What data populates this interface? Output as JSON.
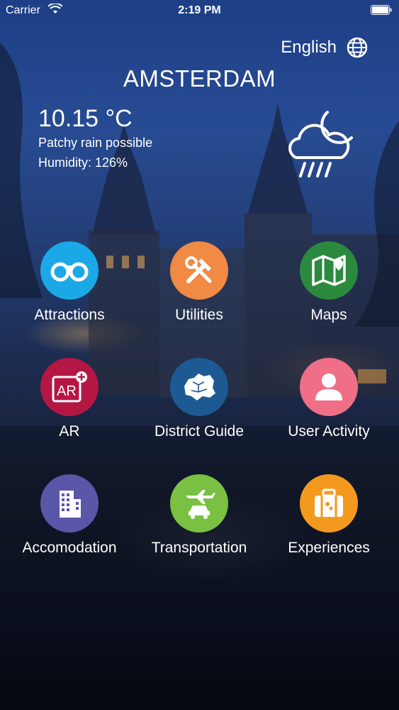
{
  "status_bar": {
    "carrier": "Carrier",
    "time": "2:19 PM"
  },
  "header": {
    "language": "English",
    "city": "AMSTERDAM"
  },
  "weather": {
    "temperature": "10.15 °C",
    "condition": "Patchy rain possible",
    "humidity": "Humidity: 126%",
    "icon": "rain-cloud-moon-icon"
  },
  "menu": [
    {
      "label": "Attractions",
      "icon": "binoculars-icon",
      "color": "#1aa9e6"
    },
    {
      "label": "Utilities",
      "icon": "tools-icon",
      "color": "#f08a44"
    },
    {
      "label": "Maps",
      "icon": "map-icon",
      "color": "#2b8a3e"
    },
    {
      "label": "AR",
      "icon": "ar-icon",
      "color": "#b51744"
    },
    {
      "label": "District Guide",
      "icon": "district-map-icon",
      "color": "#1d5a93"
    },
    {
      "label": "User Activity",
      "icon": "user-icon",
      "color": "#ee6f86"
    },
    {
      "label": "Accomodation",
      "icon": "building-icon",
      "color": "#5a56a8"
    },
    {
      "label": "Transportation",
      "icon": "plane-car-icon",
      "color": "#79c043"
    },
    {
      "label": "Experiences",
      "icon": "suitcase-icon",
      "color": "#f39a1e"
    }
  ]
}
